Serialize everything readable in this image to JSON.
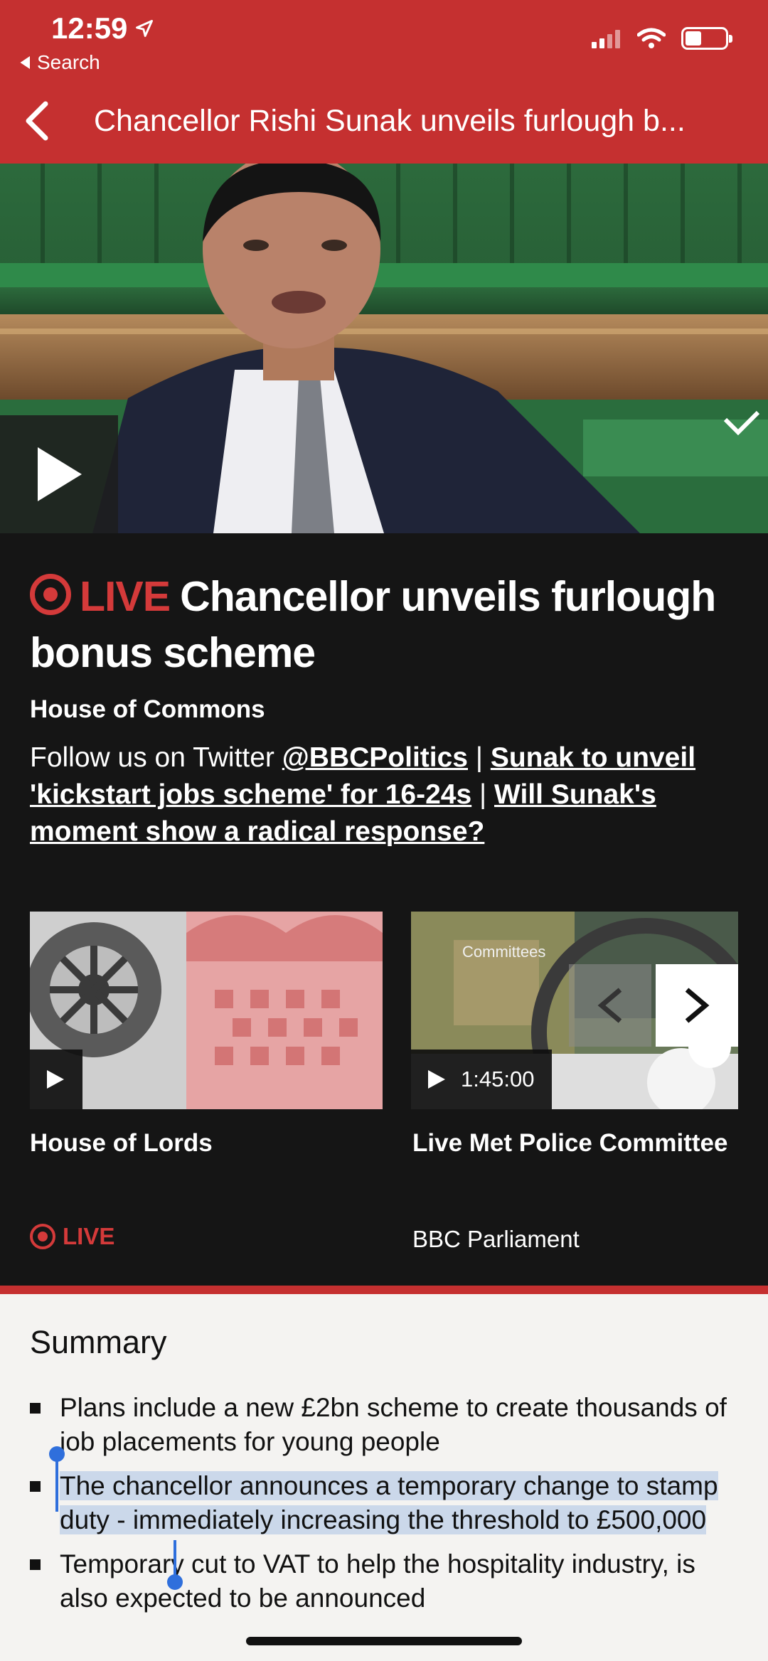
{
  "status_bar": {
    "time": "12:59",
    "back_label": "Search"
  },
  "nav": {
    "title": "Chancellor Rishi Sunak unveils furlough b..."
  },
  "live": {
    "badge": "LIVE",
    "headline": "Chancellor unveils furlough bonus scheme",
    "subtitle": "House of Commons",
    "follow_text": "Follow us on Twitter",
    "twitter_handle": "@BBCPolitics",
    "link1": "Sunak to unveil 'kickstart jobs scheme' for 16-24s",
    "link2": "Will Sunak's moment show a radical response?",
    "separator": "|"
  },
  "related": [
    {
      "title": "House of Lords",
      "duration": "",
      "status": "LIVE"
    },
    {
      "title": "Live Met Police Committee",
      "duration": "1:45:00",
      "overlay_text": "Committees",
      "channel": "BBC Parliament"
    }
  ],
  "summary": {
    "title": "Summary",
    "bullets": [
      "Plans include a new £2bn scheme to create thousands of job placements for young people",
      "The chancellor announces a temporary change to stamp duty - immediately increasing the threshold to £500,000",
      "Temporary cut to VAT to help the hospitality industry, is also expected to be announced"
    ]
  },
  "colors": {
    "brand_red": "#c53030",
    "live_red": "#d43a3a",
    "selection": "#cbd8ea"
  }
}
